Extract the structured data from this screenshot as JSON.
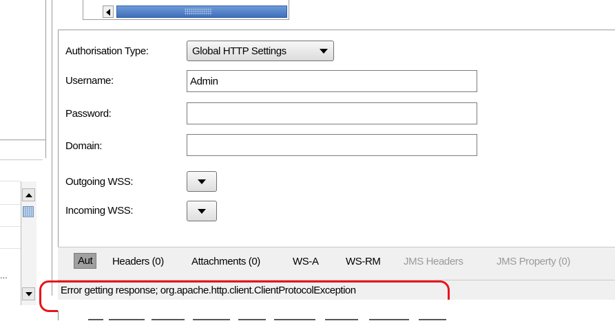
{
  "colors": {
    "highlight_border": "#e8141b",
    "scroll_thumb": "#4a7cc8",
    "active_tab_bg": "#a0a0a0"
  },
  "left_panel": {
    "ellipsis": "..."
  },
  "auth": {
    "authorisation_type_label": "Authorisation Type:",
    "authorisation_type_value": "Global HTTP Settings",
    "username_label": "Username:",
    "username_value": "Admin",
    "password_label": "Password:",
    "password_value": "",
    "domain_label": "Domain:",
    "domain_value": "",
    "outgoing_wss_label": "Outgoing WSS:",
    "incoming_wss_label": "Incoming WSS:"
  },
  "tabs": [
    {
      "label": "Aut",
      "active": true,
      "enabled": true
    },
    {
      "label": "Headers (0)",
      "active": false,
      "enabled": true
    },
    {
      "label": "Attachments (0)",
      "active": false,
      "enabled": true
    },
    {
      "label": "WS-A",
      "active": false,
      "enabled": true
    },
    {
      "label": "WS-RM",
      "active": false,
      "enabled": true
    },
    {
      "label": "JMS Headers",
      "active": false,
      "enabled": false
    },
    {
      "label": "JMS Property (0)",
      "active": false,
      "enabled": false
    }
  ],
  "status": {
    "message": "Error getting response; org.apache.http.client.ClientProtocolException"
  },
  "icons": {
    "combo_arrow": "chevron-down-icon",
    "scroll_up": "arrow-up-icon",
    "scroll_down": "arrow-down-icon",
    "scroll_left": "arrow-left-icon"
  }
}
